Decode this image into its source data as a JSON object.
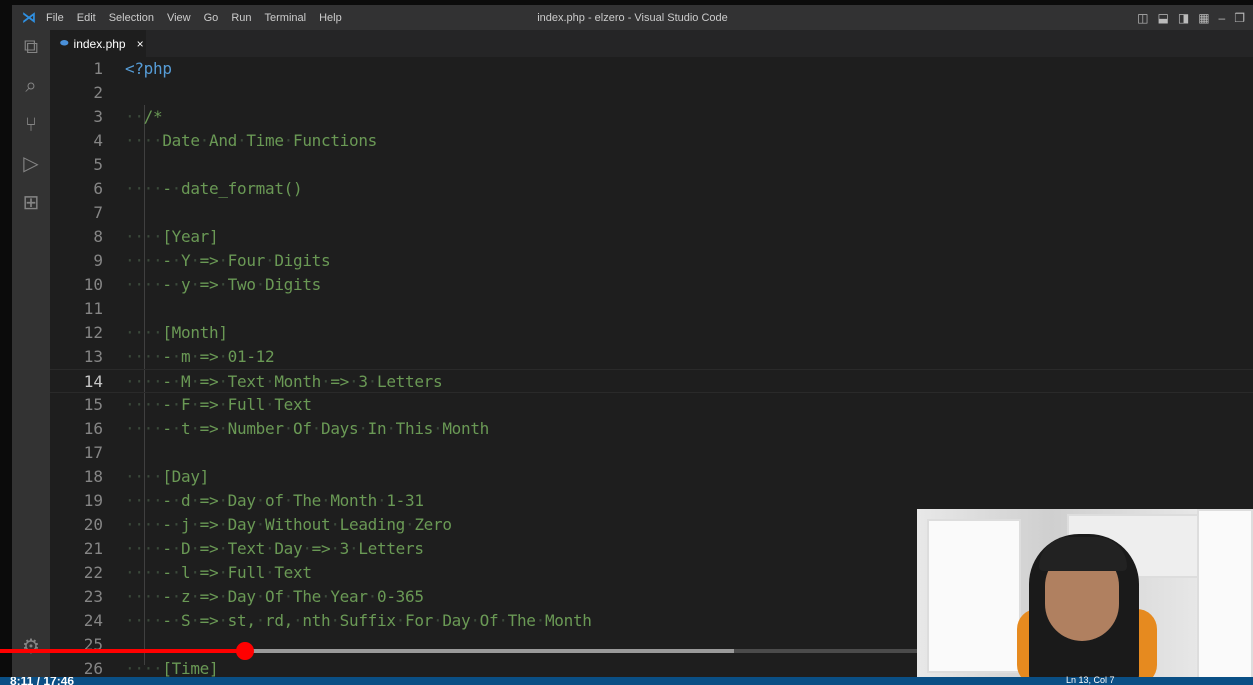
{
  "window": {
    "title": "index.php - elzero - Visual Studio Code",
    "menu": [
      "File",
      "Edit",
      "Selection",
      "View",
      "Go",
      "Run",
      "Terminal",
      "Help"
    ]
  },
  "tab": {
    "label": "index.php",
    "close": "×"
  },
  "editor": {
    "current_line": 14,
    "lines": [
      {
        "n": 1,
        "t": "<?php",
        "php": true
      },
      {
        "n": 2,
        "t": ""
      },
      {
        "n": 3,
        "t": "  /*"
      },
      {
        "n": 4,
        "t": "    Date And Time Functions"
      },
      {
        "n": 5,
        "t": ""
      },
      {
        "n": 6,
        "t": "    - date_format()"
      },
      {
        "n": 7,
        "t": ""
      },
      {
        "n": 8,
        "t": "    [Year]"
      },
      {
        "n": 9,
        "t": "    - Y => Four Digits"
      },
      {
        "n": 10,
        "t": "    - y => Two Digits"
      },
      {
        "n": 11,
        "t": ""
      },
      {
        "n": 12,
        "t": "    [Month]"
      },
      {
        "n": 13,
        "t": "    - m => 01-12"
      },
      {
        "n": 14,
        "t": "    - M => Text Month => 3 Letters"
      },
      {
        "n": 15,
        "t": "    - F => Full Text"
      },
      {
        "n": 16,
        "t": "    - t => Number Of Days In This Month"
      },
      {
        "n": 17,
        "t": ""
      },
      {
        "n": 18,
        "t": "    [Day]"
      },
      {
        "n": 19,
        "t": "    - d => Day of The Month 1-31"
      },
      {
        "n": 20,
        "t": "    - j => Day Without Leading Zero"
      },
      {
        "n": 21,
        "t": "    - D => Text Day => 3 Letters"
      },
      {
        "n": 22,
        "t": "    - l => Full Text"
      },
      {
        "n": 23,
        "t": "    - z => Day Of The Year 0-365"
      },
      {
        "n": 24,
        "t": "    - S => st, rd, nth Suffix For Day Of The Month"
      },
      {
        "n": 25,
        "t": ""
      },
      {
        "n": 26,
        "t": "    [Time]"
      }
    ]
  },
  "video": {
    "played_fraction": 0.267,
    "buffered_fraction": 0.8,
    "time": "8:11 / 17:46"
  },
  "status": {
    "position": "Ln 13, Col 7"
  },
  "colors": {
    "comment": "#6a9955",
    "keyword": "#569cd6",
    "statusbar": "#0a4f85",
    "progress": "#ff0000"
  }
}
